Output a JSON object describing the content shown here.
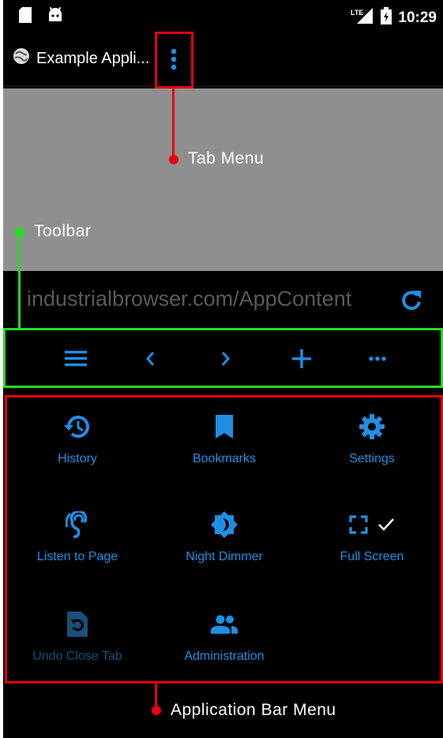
{
  "status_bar": {
    "time": "10:29",
    "network": "LTE"
  },
  "tab": {
    "title": "Example Appli..."
  },
  "url_bar": {
    "url": "industrialbrowser.com/AppContent"
  },
  "toolbar": {
    "buttons": [
      "menu-icon",
      "back-icon",
      "forward-icon",
      "add-icon",
      "more-icon"
    ]
  },
  "menu": {
    "items": [
      {
        "label": "History",
        "icon": "history-icon"
      },
      {
        "label": "Bookmarks",
        "icon": "bookmark-icon"
      },
      {
        "label": "Settings",
        "icon": "gear-icon"
      },
      {
        "label": "Listen to Page",
        "icon": "listen-icon"
      },
      {
        "label": "Night Dimmer",
        "icon": "night-dimmer-icon"
      },
      {
        "label": "Full Screen",
        "icon": "fullscreen-icon"
      },
      {
        "label": "Undo Close Tab",
        "icon": "undo-close-tab-icon"
      },
      {
        "label": "Administration",
        "icon": "people-icon"
      }
    ]
  },
  "annotations": {
    "tab_menu": "Tab Menu",
    "toolbar": "Toolbar",
    "app_bar_menu": "Application Bar Menu"
  },
  "colors": {
    "accent_blue": "#1f8fe5",
    "annotation_red": "#e8000d",
    "annotation_green": "#22dd22",
    "content_gray": "#8f8f8f"
  }
}
